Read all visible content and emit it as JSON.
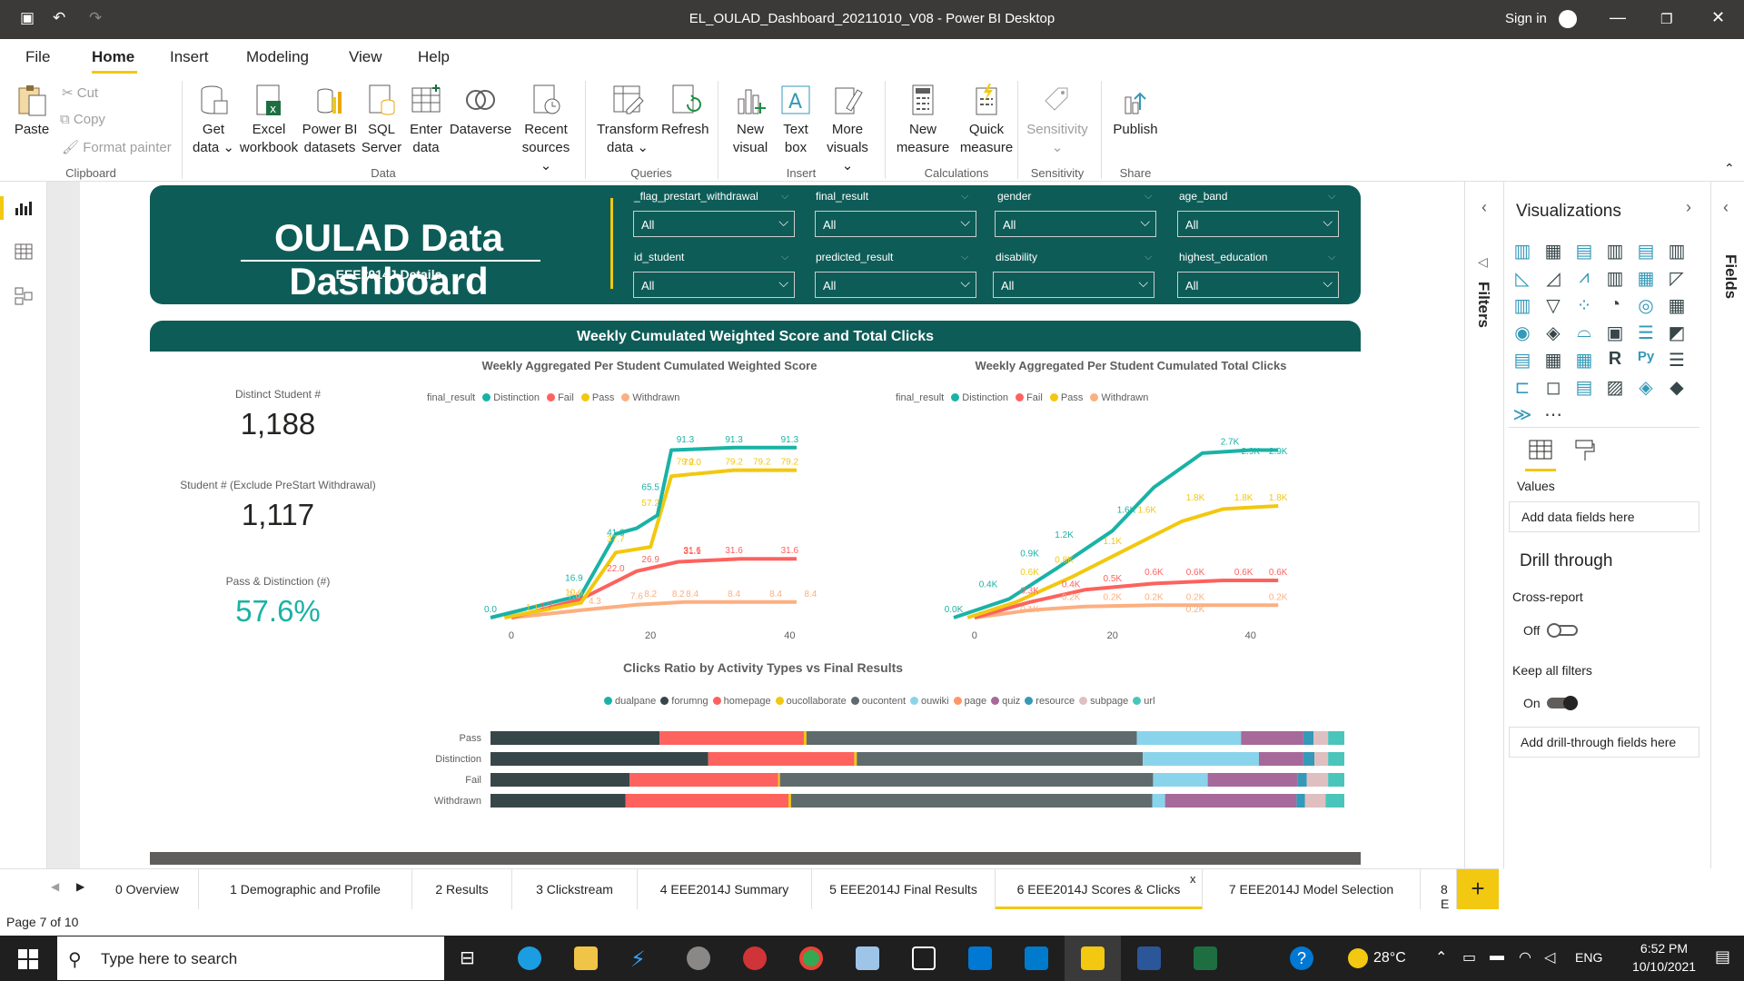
{
  "window": {
    "title": "EL_OULAD_Dashboard_20211010_V08 - Power BI Desktop",
    "sign_in": "Sign in"
  },
  "menu": [
    "File",
    "Home",
    "Insert",
    "Modeling",
    "View",
    "Help"
  ],
  "ribbon": {
    "clipboard": {
      "paste": "Paste",
      "cut": "Cut",
      "copy": "Copy",
      "format_painter": "Format painter",
      "group": "Clipboard"
    },
    "data": {
      "get_data": "Get",
      "get_data2": "data",
      "excel": "Excel",
      "excel2": "workbook",
      "pbi": "Power BI",
      "pbi2": "datasets",
      "sql": "SQL",
      "sql2": "Server",
      "enter": "Enter",
      "enter2": "data",
      "dataverse": "Dataverse",
      "recent": "Recent",
      "recent2": "sources",
      "group": "Data"
    },
    "queries": {
      "transform": "Transform",
      "transform2": "data",
      "refresh": "Refresh",
      "group": "Queries"
    },
    "insert": {
      "new_visual": "New",
      "new_visual2": "visual",
      "text_box": "Text",
      "text_box2": "box",
      "more": "More",
      "more2": "visuals",
      "group": "Insert"
    },
    "calc": {
      "new_measure": "New",
      "new_measure2": "measure",
      "quick": "Quick",
      "quick2": "measure",
      "group": "Calculations"
    },
    "sens": {
      "label": "Sensitivity",
      "group": "Sensitivity"
    },
    "share": {
      "publish": "Publish",
      "group": "Share"
    }
  },
  "dashboard": {
    "title": "OULAD Data Dashboard",
    "subtitle": "EEE2014J Details",
    "section_title": "Weekly Cumulated Weighted Score and Total Clicks"
  },
  "slicers": [
    {
      "label": "_flag_prestart_withdrawal",
      "value": "All"
    },
    {
      "label": "final_result",
      "value": "All"
    },
    {
      "label": "gender",
      "value": "All"
    },
    {
      "label": "age_band",
      "value": "All"
    },
    {
      "label": "id_student",
      "value": "All"
    },
    {
      "label": "predicted_result",
      "value": "All"
    },
    {
      "label": "disability",
      "value": "All"
    },
    {
      "label": "highest_education",
      "value": "All"
    }
  ],
  "kpis": [
    {
      "label": "Distinct Student #",
      "value": "1,188"
    },
    {
      "label": "Student # (Exclude PreStart Withdrawal)",
      "value": "1,117"
    },
    {
      "label": "Pass & Distinction (#)",
      "value": "57.6%"
    }
  ],
  "colors": {
    "Distinction": "#1ab2a6",
    "Fail": "#fd625e",
    "Pass": "#f2c80f",
    "Withdrawn": "#fcaf80",
    "accent": "#0e5c57",
    "yellow": "#f2c811"
  },
  "chart_data": [
    {
      "type": "line",
      "title": "Weekly Aggregated Per Student Cumulated Weighted Score",
      "legend_title": "final_result",
      "x_ticks": [
        0,
        20,
        40
      ],
      "series": [
        {
          "name": "Distinction",
          "points": [
            [
              -3,
              0
            ],
            [
              10,
              12
            ],
            [
              15,
              45
            ],
            [
              18,
              48
            ],
            [
              21,
              55
            ],
            [
              23,
              90
            ],
            [
              32,
              91.3
            ],
            [
              41,
              91.3
            ]
          ],
          "labels": [
            {
              "x": 25,
              "y": 91.3,
              "t": "91.3"
            },
            {
              "x": 32,
              "y": 91.3,
              "t": "91.3"
            },
            {
              "x": 40,
              "y": 91.3,
              "t": "91.3"
            },
            {
              "x": 20,
              "y": 65.5,
              "t": "65.5"
            },
            {
              "x": 15,
              "y": 41.3,
              "t": "41.3"
            },
            {
              "x": 9,
              "y": 16.9,
              "t": "16.9"
            },
            {
              "x": -3,
              "y": 0,
              "t": "0.0"
            }
          ]
        },
        {
          "name": "Pass",
          "points": [
            [
              -1,
              0
            ],
            [
              10,
              8
            ],
            [
              15,
              35
            ],
            [
              20,
              38
            ],
            [
              23,
              76
            ],
            [
              32,
              79.2
            ],
            [
              41,
              79.2
            ]
          ],
          "labels": [
            {
              "x": 25,
              "y": 79.2,
              "t": "79.2"
            },
            {
              "x": 36,
              "y": 79.2,
              "t": "79.2"
            },
            {
              "x": 40,
              "y": 79.2,
              "t": "79.2"
            },
            {
              "x": 26,
              "y": 79,
              "t": "79.0"
            },
            {
              "x": 32,
              "y": 79.2,
              "t": "79.2"
            },
            {
              "x": 20,
              "y": 57,
              "t": "57.2"
            },
            {
              "x": 15,
              "y": 37.7,
              "t": "37.7"
            },
            {
              "x": 9,
              "y": 9,
              "t": "10.6"
            },
            {
              "x": 3,
              "y": 1,
              "t": "1.1"
            }
          ]
        },
        {
          "name": "Fail",
          "points": [
            [
              0,
              0
            ],
            [
              10,
              10
            ],
            [
              18,
              25
            ],
            [
              24,
              30
            ],
            [
              33,
              31.6
            ],
            [
              41,
              31.6
            ]
          ],
          "labels": [
            {
              "x": 26,
              "y": 31.6,
              "t": "31.6"
            },
            {
              "x": 32,
              "y": 31.6,
              "t": "31.6"
            },
            {
              "x": 40,
              "y": 31.6,
              "t": "31.6"
            },
            {
              "x": 20,
              "y": 26.9,
              "t": "26.9"
            },
            {
              "x": 26,
              "y": 31.1,
              "t": "31.1"
            },
            {
              "x": 15,
              "y": 22,
              "t": "22.0"
            },
            {
              "x": 5,
              "y": 1.7,
              "t": "1.7"
            }
          ]
        },
        {
          "name": "Withdrawn",
          "points": [
            [
              0,
              0
            ],
            [
              10,
              4
            ],
            [
              18,
              7
            ],
            [
              25,
              8.4
            ],
            [
              41,
              8.4
            ]
          ],
          "labels": [
            {
              "x": 20,
              "y": 8.2,
              "t": "8.2"
            },
            {
              "x": 24,
              "y": 8.2,
              "t": "8.2"
            },
            {
              "x": 32,
              "y": 8.4,
              "t": "8.4"
            },
            {
              "x": 38,
              "y": 8.4,
              "t": "8.4"
            },
            {
              "x": 43,
              "y": 8.4,
              "t": "8.4"
            },
            {
              "x": 26,
              "y": 8.4,
              "t": "8.4"
            },
            {
              "x": 12,
              "y": 4.3,
              "t": "4.3"
            },
            {
              "x": 9,
              "y": 7.6,
              "t": "7.6"
            },
            {
              "x": 18,
              "y": 7,
              "t": "7.6"
            }
          ]
        }
      ],
      "ylim": [
        0,
        100
      ],
      "xlim": [
        -3,
        44
      ]
    },
    {
      "type": "line",
      "title": "Weekly Aggregated Per Student Cumulated Total Clicks",
      "legend_title": "final_result",
      "x_ticks": [
        0,
        20,
        40
      ],
      "series": [
        {
          "name": "Distinction",
          "points": [
            [
              -3,
              0
            ],
            [
              5,
              300
            ],
            [
              12,
              800
            ],
            [
              20,
              1400
            ],
            [
              26,
              2100
            ],
            [
              33,
              2650
            ],
            [
              40,
              2700
            ],
            [
              44,
              2700
            ]
          ],
          "labels": [
            {
              "x": 37,
              "y": 2700,
              "t": "2.7K"
            },
            {
              "x": 40,
              "y": 2550,
              "t": "2.9K"
            },
            {
              "x": 44,
              "y": 2550,
              "t": "2.9K"
            },
            {
              "x": 22,
              "y": 1600,
              "t": "1.6K"
            },
            {
              "x": 13,
              "y": 1200,
              "t": "1.2K"
            },
            {
              "x": 8,
              "y": 900,
              "t": "0.9K"
            },
            {
              "x": 2,
              "y": 400,
              "t": "0.4K"
            },
            {
              "x": -3,
              "y": 0,
              "t": "0.0K"
            }
          ]
        },
        {
          "name": "Pass",
          "points": [
            [
              -1,
              0
            ],
            [
              6,
              250
            ],
            [
              14,
              650
            ],
            [
              22,
              1100
            ],
            [
              30,
              1550
            ],
            [
              36,
              1750
            ],
            [
              44,
              1800
            ]
          ],
          "labels": [
            {
              "x": 32,
              "y": 1800,
              "t": "1.8K"
            },
            {
              "x": 39,
              "y": 1800,
              "t": "1.8K"
            },
            {
              "x": 44,
              "y": 1800,
              "t": "1.8K"
            },
            {
              "x": 25,
              "y": 1600,
              "t": "1.6K"
            },
            {
              "x": 20,
              "y": 1100,
              "t": "1.1K"
            },
            {
              "x": 13,
              "y": 800,
              "t": "0.8K"
            },
            {
              "x": 8,
              "y": 600,
              "t": "0.6K"
            }
          ]
        },
        {
          "name": "Fail",
          "points": [
            [
              0,
              0
            ],
            [
              8,
              250
            ],
            [
              16,
              450
            ],
            [
              26,
              550
            ],
            [
              36,
              600
            ],
            [
              44,
              600
            ]
          ],
          "labels": [
            {
              "x": 20,
              "y": 500,
              "t": "0.5K"
            },
            {
              "x": 26,
              "y": 600,
              "t": "0.6K"
            },
            {
              "x": 32,
              "y": 600,
              "t": "0.6K"
            },
            {
              "x": 39,
              "y": 600,
              "t": "0.6K"
            },
            {
              "x": 44,
              "y": 600,
              "t": "0.6K"
            },
            {
              "x": 14,
              "y": 400,
              "t": "0.4K"
            },
            {
              "x": 8,
              "y": 300,
              "t": "0.3K"
            }
          ]
        },
        {
          "name": "Withdrawn",
          "points": [
            [
              0,
              0
            ],
            [
              8,
              120
            ],
            [
              16,
              180
            ],
            [
              26,
              200
            ],
            [
              44,
              200
            ]
          ],
          "labels": [
            {
              "x": 14,
              "y": 200,
              "t": "0.2K"
            },
            {
              "x": 20,
              "y": 200,
              "t": "0.2K"
            },
            {
              "x": 26,
              "y": 200,
              "t": "0.2K"
            },
            {
              "x": 32,
              "y": 200,
              "t": "0.2K"
            },
            {
              "x": 44,
              "y": 200,
              "t": "0.2K"
            },
            {
              "x": 32,
              "y": 0,
              "t": "0.2K"
            },
            {
              "x": 8,
              "y": 0,
              "t": "0.1K"
            }
          ]
        }
      ],
      "ylim": [
        0,
        3000
      ],
      "xlim": [
        -3,
        47
      ]
    },
    {
      "type": "bar",
      "stacked": "100%",
      "orientation": "horizontal",
      "title": "Clicks Ratio by Activity Types vs Final Results",
      "categories": [
        "Pass",
        "Distinction",
        "Fail",
        "Withdrawn"
      ],
      "series": [
        {
          "name": "dualpane",
          "color": "#1ab2a6",
          "values": [
            0,
            0,
            0,
            0
          ]
        },
        {
          "name": "forumng",
          "color": "#374649",
          "values": [
            19.8,
            25.5,
            16.3,
            15.8
          ]
        },
        {
          "name": "homepage",
          "color": "#fd625e",
          "values": [
            16.9,
            17.1,
            17.4,
            19.1
          ]
        },
        {
          "name": "oucollaborate",
          "color": "#f2c80f",
          "values": [
            0.3,
            0.3,
            0.2,
            0.3
          ]
        },
        {
          "name": "oucontent",
          "color": "#5f6b6d",
          "values": [
            38.7,
            33.5,
            43.7,
            42.3
          ]
        },
        {
          "name": "ouwiki",
          "color": "#8ad4eb",
          "values": [
            12.2,
            13.6,
            6.4,
            1.5
          ]
        },
        {
          "name": "page",
          "color": "#fe9666",
          "values": [
            0,
            0,
            0,
            0
          ]
        },
        {
          "name": "quiz",
          "color": "#a66999",
          "values": [
            7.3,
            5.2,
            10.5,
            15.4
          ]
        },
        {
          "name": "resource",
          "color": "#3599b8",
          "values": [
            1.2,
            1.3,
            1.1,
            1.0
          ]
        },
        {
          "name": "subpage",
          "color": "#dfbfbf",
          "values": [
            1.7,
            1.6,
            2.5,
            2.4
          ]
        },
        {
          "name": "url",
          "color": "#4ac5bb",
          "values": [
            1.9,
            1.9,
            1.9,
            2.2
          ]
        }
      ]
    }
  ],
  "right_panel": {
    "viz_title": "Visualizations",
    "filters": "Filters",
    "fields": "Fields",
    "values": "Values",
    "add_data": "Add data fields here",
    "drill": "Drill through",
    "cross_report": "Cross-report",
    "off": "Off",
    "keep": "Keep all filters",
    "on": "On",
    "add_drill": "Add drill-through fields here"
  },
  "tabs": [
    "0 Overview",
    "1 Demographic and Profile",
    "2 Results",
    "3 Clickstream",
    "4 EEE2014J Summary",
    "5 EEE2014J Final Results",
    "6 EEE2014J Scores & Clicks",
    "7 EEE2014J Model Selection",
    "8 E"
  ],
  "tab_close": "x",
  "status": "Page 7 of 10",
  "taskbar": {
    "search": "Type here to search",
    "weather": "28°C",
    "lang": "ENG",
    "time": "6:52 PM",
    "date": "10/10/2021"
  }
}
